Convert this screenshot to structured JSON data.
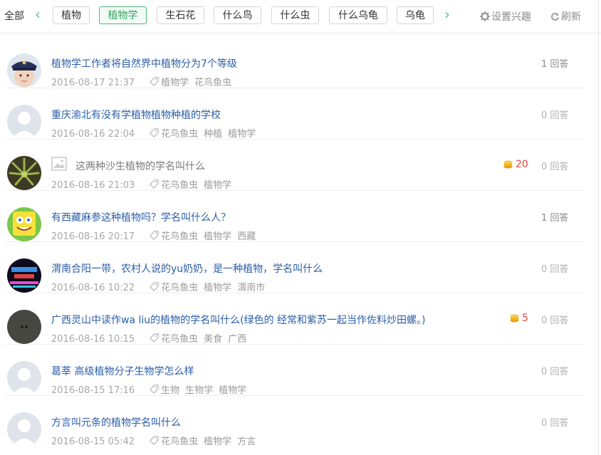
{
  "topbar": {
    "all_label": "全部",
    "left_arrow": "‹",
    "right_arrow": "›",
    "tags": [
      {
        "label": "植物",
        "active": false
      },
      {
        "label": "植物学",
        "active": true
      },
      {
        "label": "生石花",
        "active": false
      },
      {
        "label": "什么鸟",
        "active": false
      },
      {
        "label": "什么虫",
        "active": false
      },
      {
        "label": "什么乌龟",
        "active": false
      },
      {
        "label": "乌龟",
        "active": false
      }
    ],
    "settings_label": "设置兴趣",
    "refresh_label": "刷新"
  },
  "colors": {
    "accent_green": "#4cb87a",
    "title_blue": "#2b5ea8",
    "bounty_red": "#e0453c",
    "coin_gold": "#f3b21b"
  },
  "questions": [
    {
      "title": "植物学工作者将自然界中植物分为7个等级",
      "time": "2016-08-17 21:37",
      "tags": [
        "植物学",
        "花鸟鱼虫"
      ],
      "answers": "1 回答",
      "bounty": "",
      "avatar": "police-kid-avatar"
    },
    {
      "title": "重庆渝北有没有学植物植物种植的学校",
      "time": "2016-08-16 22:04",
      "tags": [
        "花鸟鱼虫",
        "种植",
        "植物学"
      ],
      "answers": "0 回答",
      "bounty": "",
      "avatar": "default-avatar"
    },
    {
      "title": "这两种沙生植物的学名叫什么",
      "time": "2016-08-16 21:03",
      "tags": [
        "花鸟鱼虫",
        "植物学"
      ],
      "answers": "0 回答",
      "bounty": "20",
      "avatar": "plant-avatar",
      "has_image": true
    },
    {
      "title": "有西藏麻参这种植物吗？学名叫什么人？",
      "time": "2016-08-16 20:17",
      "tags": [
        "花鸟鱼虫",
        "植物学",
        "西藏"
      ],
      "answers": "1 回答",
      "bounty": "",
      "avatar": "sponge-avatar"
    },
    {
      "title": "渭南合阳一带，农村人说的yu奶奶，是一种植物，学名叫什么",
      "time": "2016-08-16 10:22",
      "tags": [
        "花鸟鱼虫",
        "植物学",
        "渭南市"
      ],
      "answers": "0 回答",
      "bounty": "",
      "avatar": "tech-avatar"
    },
    {
      "title": "广西灵山中读作wa liu的植物的学名叫什么(绿色的 经常和紫苏一起当作佐料炒田螺。)",
      "time": "2016-08-16 10:15",
      "tags": [
        "花鸟鱼虫",
        "美食",
        "广西"
      ],
      "answers": "0 回答",
      "bounty": "5",
      "avatar": "dark-avatar"
    },
    {
      "title": "葛莘 高级植物分子生物学怎么样",
      "time": "2016-08-15 17:16",
      "tags": [
        "生物",
        "生物学",
        "植物学"
      ],
      "answers": "0 回答",
      "bounty": "",
      "avatar": "default-avatar"
    },
    {
      "title": "方言叫元条的植物学名叫什么",
      "time": "2016-08-15 05:42",
      "tags": [
        "花鸟鱼虫",
        "植物学",
        "方言"
      ],
      "answers": "0 回答",
      "bounty": "",
      "avatar": "default-avatar"
    }
  ]
}
